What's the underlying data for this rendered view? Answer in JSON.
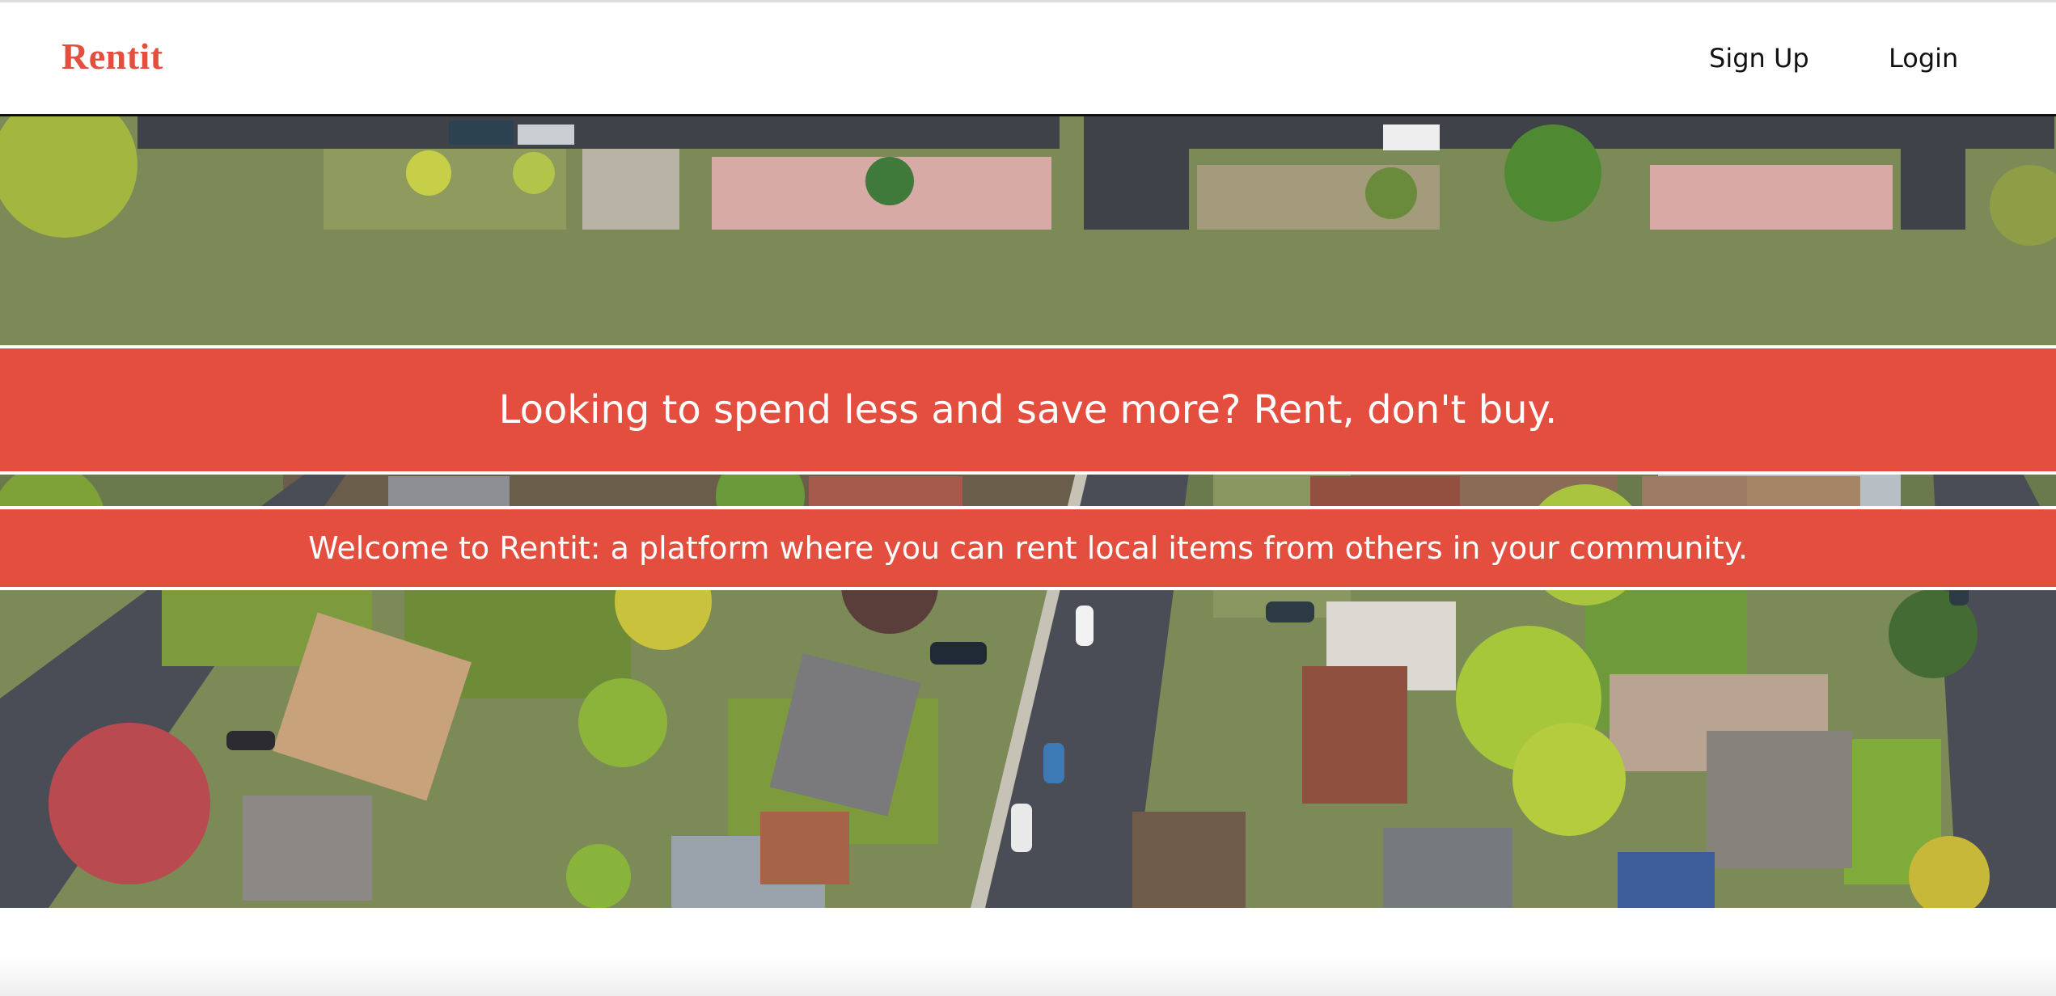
{
  "nav": {
    "brand": "Rentit",
    "signup_label": "Sign Up",
    "login_label": "Login"
  },
  "hero": {
    "image_alt": "Aerial view of a suburban neighborhood",
    "headline": "Looking to spend less and save more? Rent, don't buy.",
    "subheadline": "Welcome to Rentit: a platform where you can rent local items from others in your community."
  },
  "colors": {
    "accent": "#e44e3e",
    "banner_text": "#ffffff",
    "nav_text": "#111111"
  }
}
